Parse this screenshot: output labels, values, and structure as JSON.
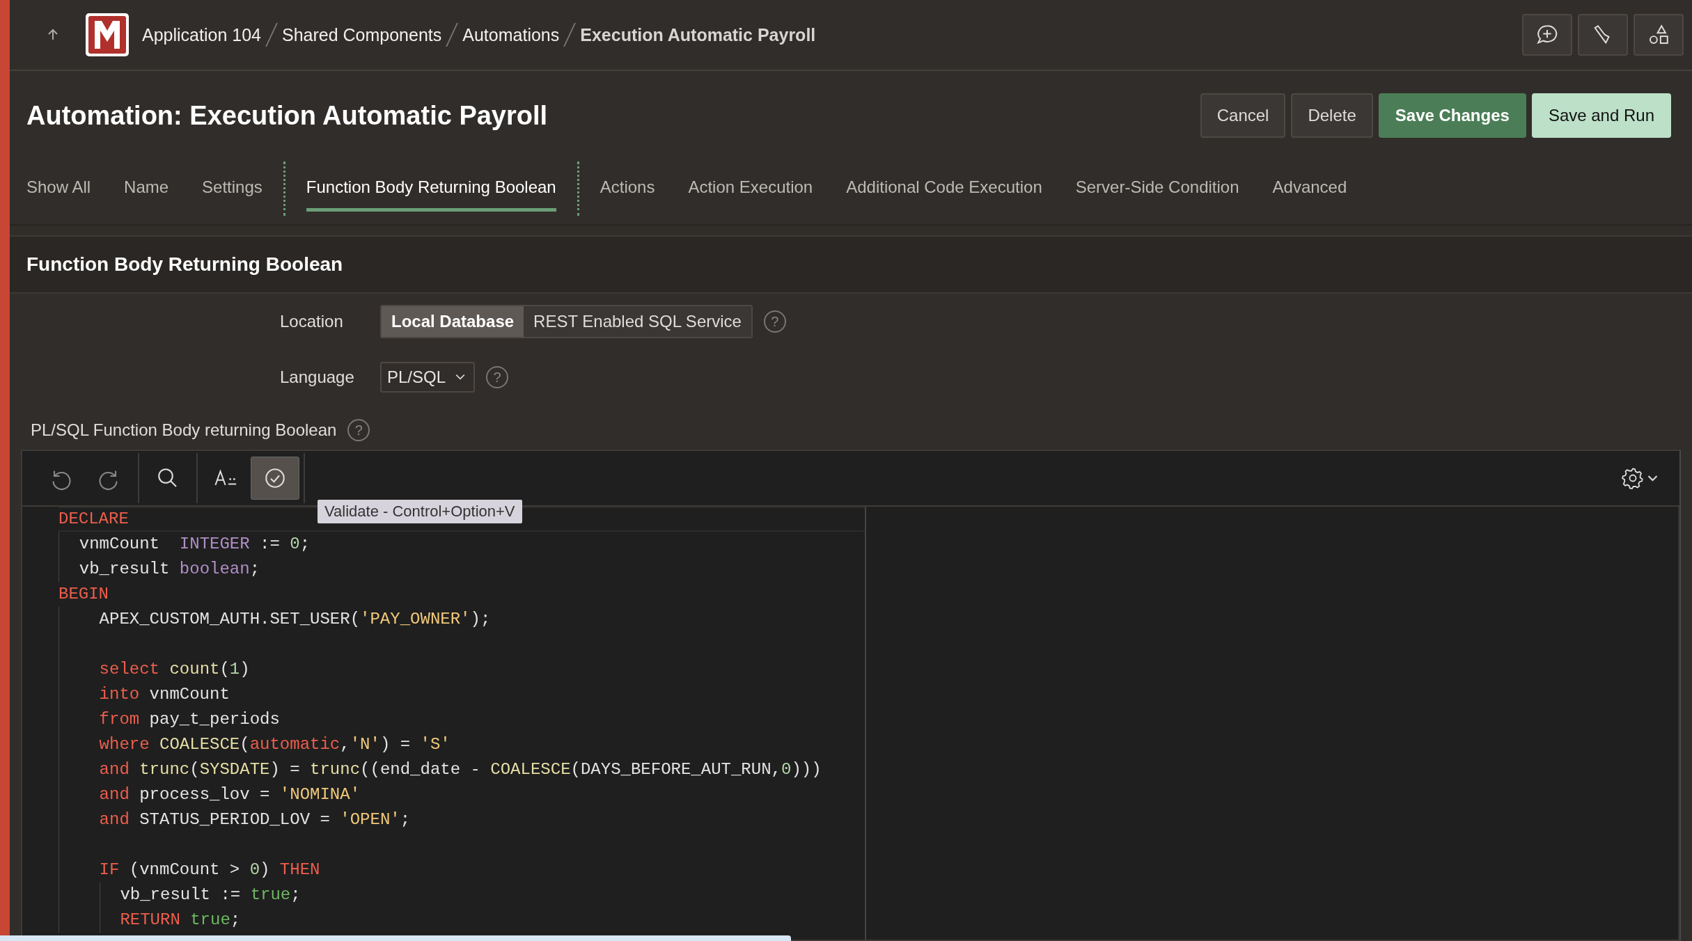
{
  "breadcrumb": {
    "items": [
      {
        "label": "Application 104",
        "current": false
      },
      {
        "label": "Shared Components",
        "current": false
      },
      {
        "label": "Automations",
        "current": false
      },
      {
        "label": "Execution Automatic Payroll",
        "current": true
      }
    ]
  },
  "header": {
    "title": "Automation: Execution Automatic Payroll",
    "buttons": [
      {
        "label": "Cancel",
        "kind": "plain"
      },
      {
        "label": "Delete",
        "kind": "plain"
      },
      {
        "label": "Save Changes",
        "kind": "primary"
      },
      {
        "label": "Save and Run",
        "kind": "light"
      }
    ]
  },
  "tabs": [
    {
      "label": "Show All",
      "selected": false
    },
    {
      "label": "Name",
      "selected": false
    },
    {
      "label": "Settings",
      "selected": false
    },
    {
      "label": "Function Body Returning Boolean",
      "selected": true
    },
    {
      "label": "Actions",
      "selected": false
    },
    {
      "label": "Action Execution",
      "selected": false
    },
    {
      "label": "Additional Code Execution",
      "selected": false
    },
    {
      "label": "Server-Side Condition",
      "selected": false
    },
    {
      "label": "Advanced",
      "selected": false
    }
  ],
  "section": {
    "title": "Function Body Returning Boolean",
    "location": {
      "label": "Location",
      "options": [
        {
          "label": "Local Database",
          "selected": true
        },
        {
          "label": "REST Enabled SQL Service",
          "selected": false
        }
      ],
      "help": "?"
    },
    "language": {
      "label": "Language",
      "value": "PL/SQL",
      "help": "?"
    },
    "editor": {
      "label": "PL/SQL Function Body returning Boolean",
      "help": "?",
      "tooltip": "Validate - Control+Option+V",
      "lines": [
        {
          "kind": "line",
          "tokens": [
            {
              "text": "DECLARE",
              "kind": "keyword"
            }
          ],
          "children": [
            {
              "kind": "line",
              "tokens": [
                {
                  "text": "vnmCount  ",
                  "kind": "plain"
                },
                {
                  "text": "INTEGER",
                  "kind": "type"
                },
                {
                  "text": " := ",
                  "kind": "plain"
                },
                {
                  "text": "0",
                  "kind": "number"
                },
                {
                  "text": ";",
                  "kind": "plain"
                }
              ]
            },
            {
              "kind": "line",
              "tokens": [
                {
                  "text": "vb_result ",
                  "kind": "plain"
                },
                {
                  "text": "boolean",
                  "kind": "type"
                },
                {
                  "text": ";",
                  "kind": "plain"
                }
              ]
            }
          ]
        },
        {
          "kind": "line",
          "tokens": [
            {
              "text": "BEGIN",
              "kind": "keyword"
            }
          ],
          "children": [
            {
              "kind": "block",
              "children": [
                {
                  "kind": "line",
                  "tokens": [
                    {
                      "text": "APEX_CUSTOM_AUTH.SET_USER(",
                      "kind": "plain"
                    },
                    {
                      "text": "'PAY_OWNER'",
                      "kind": "string"
                    },
                    {
                      "text": ");",
                      "kind": "plain"
                    }
                  ]
                },
                {
                  "kind": "blank"
                },
                {
                  "kind": "line",
                  "tokens": [
                    {
                      "text": "select ",
                      "kind": "keyword"
                    },
                    {
                      "text": "count",
                      "kind": "function"
                    },
                    {
                      "text": "(",
                      "kind": "plain"
                    },
                    {
                      "text": "1",
                      "kind": "number"
                    },
                    {
                      "text": ")",
                      "kind": "plain"
                    }
                  ]
                },
                {
                  "kind": "line",
                  "tokens": [
                    {
                      "text": "into",
                      "kind": "keyword"
                    },
                    {
                      "text": " vnmCount",
                      "kind": "plain"
                    }
                  ]
                },
                {
                  "kind": "line",
                  "tokens": [
                    {
                      "text": "from",
                      "kind": "keyword"
                    },
                    {
                      "text": " pay_t_periods",
                      "kind": "plain"
                    }
                  ]
                },
                {
                  "kind": "line",
                  "tokens": [
                    {
                      "text": "where ",
                      "kind": "keyword"
                    },
                    {
                      "text": "COALESCE",
                      "kind": "function"
                    },
                    {
                      "text": "(",
                      "kind": "plain"
                    },
                    {
                      "text": "automatic",
                      "kind": "keyword"
                    },
                    {
                      "text": ",",
                      "kind": "plain"
                    },
                    {
                      "text": "'N'",
                      "kind": "string"
                    },
                    {
                      "text": ") = ",
                      "kind": "plain"
                    },
                    {
                      "text": "'S'",
                      "kind": "string"
                    }
                  ]
                },
                {
                  "kind": "line",
                  "tokens": [
                    {
                      "text": "and ",
                      "kind": "keyword"
                    },
                    {
                      "text": "trunc",
                      "kind": "function"
                    },
                    {
                      "text": "(",
                      "kind": "plain"
                    },
                    {
                      "text": "SYSDATE",
                      "kind": "function"
                    },
                    {
                      "text": ") = ",
                      "kind": "plain"
                    },
                    {
                      "text": "trunc",
                      "kind": "function"
                    },
                    {
                      "text": "((end_date - ",
                      "kind": "plain"
                    },
                    {
                      "text": "COALESCE",
                      "kind": "function"
                    },
                    {
                      "text": "(DAYS_BEFORE_AUT_RUN,",
                      "kind": "plain"
                    },
                    {
                      "text": "0",
                      "kind": "number"
                    },
                    {
                      "text": ")))",
                      "kind": "plain"
                    }
                  ]
                },
                {
                  "kind": "line",
                  "tokens": [
                    {
                      "text": "and",
                      "kind": "keyword"
                    },
                    {
                      "text": " process_lov = ",
                      "kind": "plain"
                    },
                    {
                      "text": "'NOMINA'",
                      "kind": "string"
                    }
                  ]
                },
                {
                  "kind": "line",
                  "tokens": [
                    {
                      "text": "and",
                      "kind": "keyword"
                    },
                    {
                      "text": " STATUS_PERIOD_LOV = ",
                      "kind": "plain"
                    },
                    {
                      "text": "'OPEN'",
                      "kind": "string"
                    },
                    {
                      "text": ";",
                      "kind": "plain"
                    }
                  ]
                },
                {
                  "kind": "blank"
                },
                {
                  "kind": "line",
                  "tokens": [
                    {
                      "text": "IF",
                      "kind": "keyword"
                    },
                    {
                      "text": " (vnmCount > ",
                      "kind": "plain"
                    },
                    {
                      "text": "0",
                      "kind": "number"
                    },
                    {
                      "text": ") ",
                      "kind": "plain"
                    },
                    {
                      "text": "THEN",
                      "kind": "keyword"
                    }
                  ],
                  "children": [
                    {
                      "kind": "line",
                      "tokens": [
                        {
                          "text": "vb_result := ",
                          "kind": "plain"
                        },
                        {
                          "text": "true",
                          "kind": "boolean"
                        },
                        {
                          "text": ";",
                          "kind": "plain"
                        }
                      ]
                    },
                    {
                      "kind": "line",
                      "tokens": [
                        {
                          "text": "RETURN ",
                          "kind": "keyword"
                        },
                        {
                          "text": "true",
                          "kind": "boolean"
                        },
                        {
                          "text": ";",
                          "kind": "plain"
                        }
                      ]
                    }
                  ]
                }
              ]
            }
          ]
        }
      ]
    }
  }
}
